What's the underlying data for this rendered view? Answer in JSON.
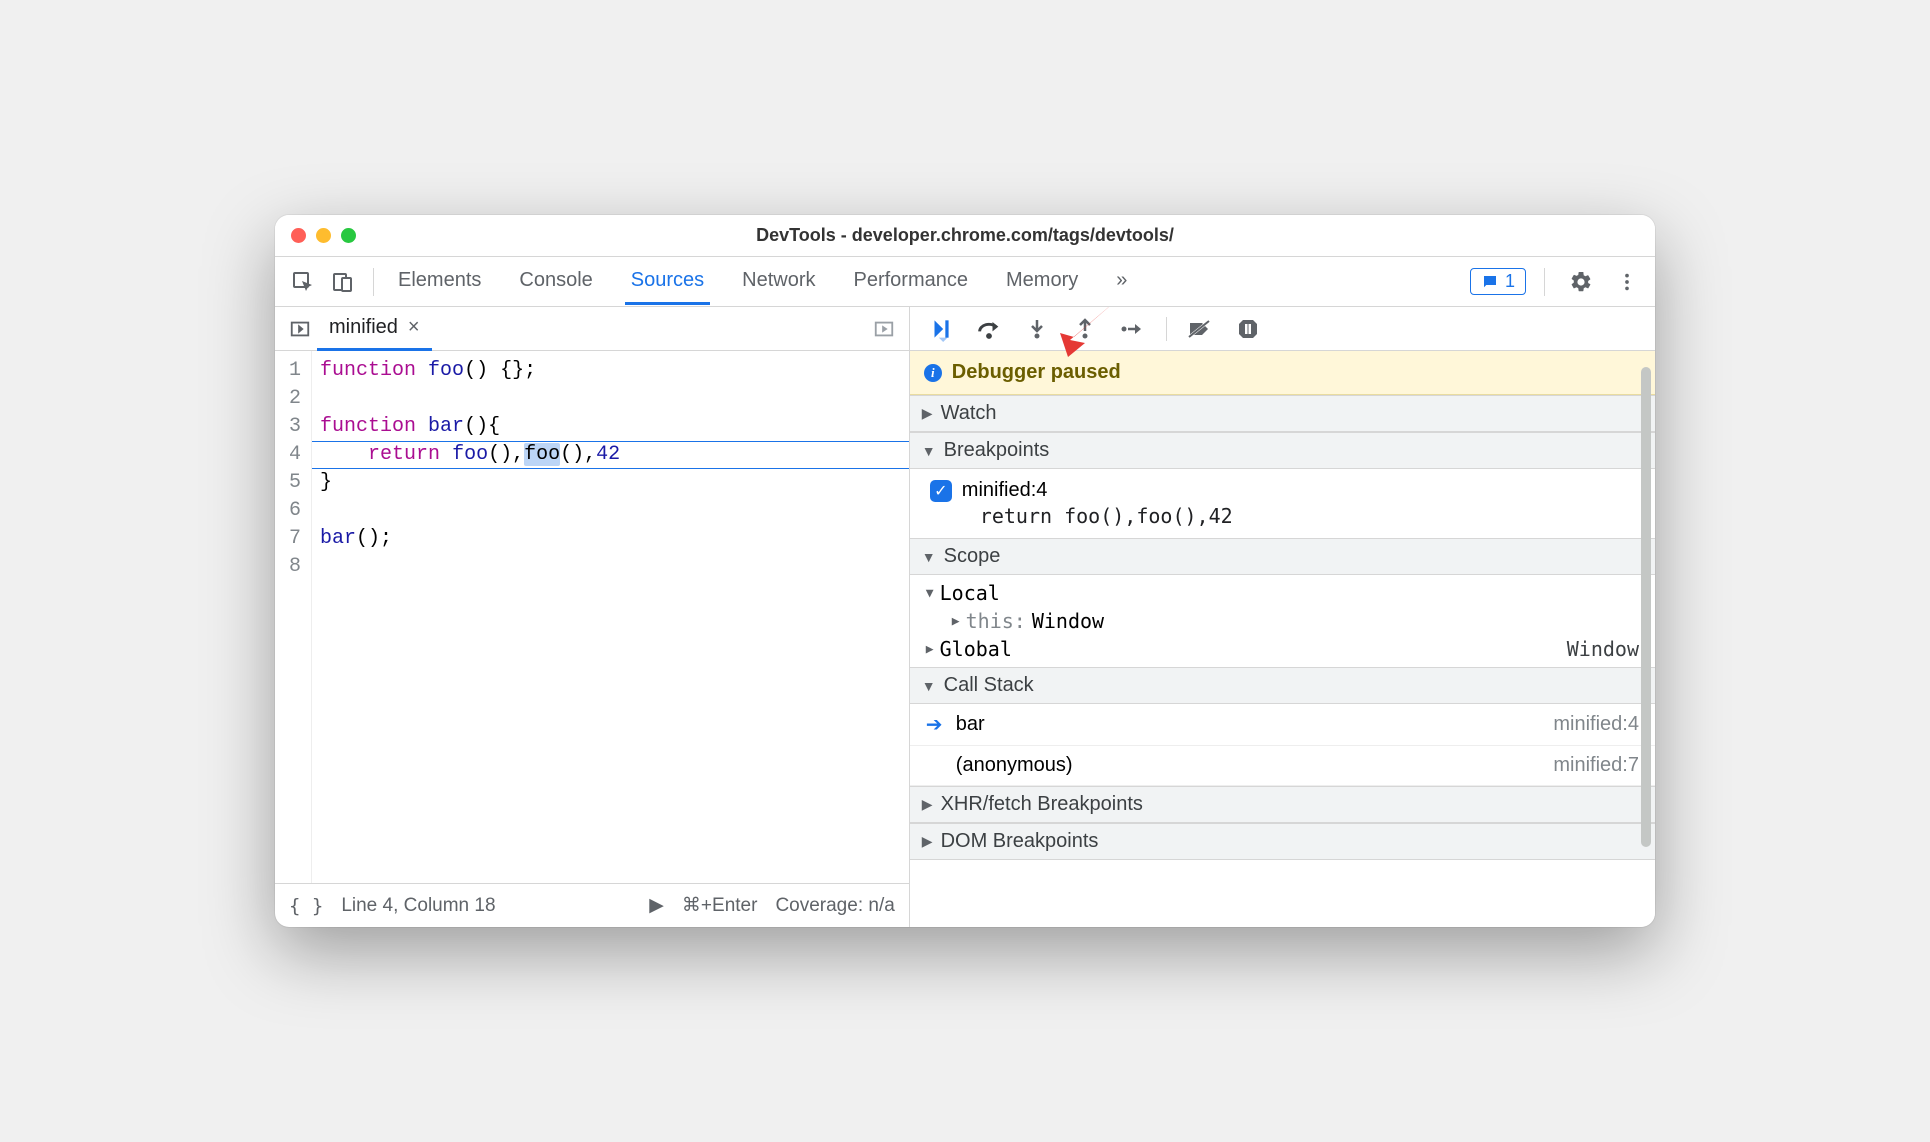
{
  "window": {
    "title": "DevTools - developer.chrome.com/tags/devtools/"
  },
  "topbar": {
    "tabs": [
      "Elements",
      "Console",
      "Sources",
      "Network",
      "Performance",
      "Memory"
    ],
    "active_tab": "Sources",
    "more_indicator": "»",
    "issue_count": "1"
  },
  "file_tab": {
    "name": "minified",
    "close": "×"
  },
  "editor": {
    "lines": [
      {
        "n": "1",
        "segments": [
          [
            "kw",
            "function "
          ],
          [
            "fn",
            "foo"
          ],
          [
            "",
            "() {};"
          ]
        ]
      },
      {
        "n": "2",
        "segments": [
          [
            "",
            ""
          ]
        ]
      },
      {
        "n": "3",
        "segments": [
          [
            "kw",
            "function "
          ],
          [
            "fn",
            "bar"
          ],
          [
            "",
            "(){"
          ]
        ]
      },
      {
        "n": "4",
        "segments": [
          [
            "",
            "    "
          ],
          [
            "kw",
            "return"
          ],
          [
            "",
            " "
          ],
          [
            "fn",
            "foo"
          ],
          [
            "",
            "(),"
          ],
          [
            "sel",
            "foo"
          ],
          [
            "",
            "(),"
          ],
          [
            "num",
            "42"
          ]
        ]
      },
      {
        "n": "5",
        "segments": [
          [
            "",
            "}"
          ]
        ]
      },
      {
        "n": "6",
        "segments": [
          [
            "",
            ""
          ]
        ]
      },
      {
        "n": "7",
        "segments": [
          [
            "fn",
            "bar"
          ],
          [
            "",
            "();"
          ]
        ]
      },
      {
        "n": "8",
        "segments": [
          [
            "",
            ""
          ]
        ]
      }
    ],
    "highlighted_line_index": 3
  },
  "statusbar": {
    "braces": "{ }",
    "position": "Line 4, Column 18",
    "run_hint": "⌘+Enter",
    "coverage": "Coverage: n/a"
  },
  "debugger": {
    "paused_text": "Debugger paused",
    "sections": {
      "watch": "Watch",
      "breakpoints": "Breakpoints",
      "scope": "Scope",
      "callstack": "Call Stack",
      "xhr": "XHR/fetch Breakpoints",
      "dom": "DOM Breakpoints"
    },
    "breakpoint": {
      "label": "minified:4",
      "code": "return foo(),foo(),42"
    },
    "scope": {
      "local_label": "Local",
      "this_label": "this",
      "this_value": "Window",
      "global_label": "Global",
      "global_value": "Window"
    },
    "callstack": [
      {
        "name": "bar",
        "loc": "minified:4",
        "current": true
      },
      {
        "name": "(anonymous)",
        "loc": "minified:7",
        "current": false
      }
    ]
  }
}
